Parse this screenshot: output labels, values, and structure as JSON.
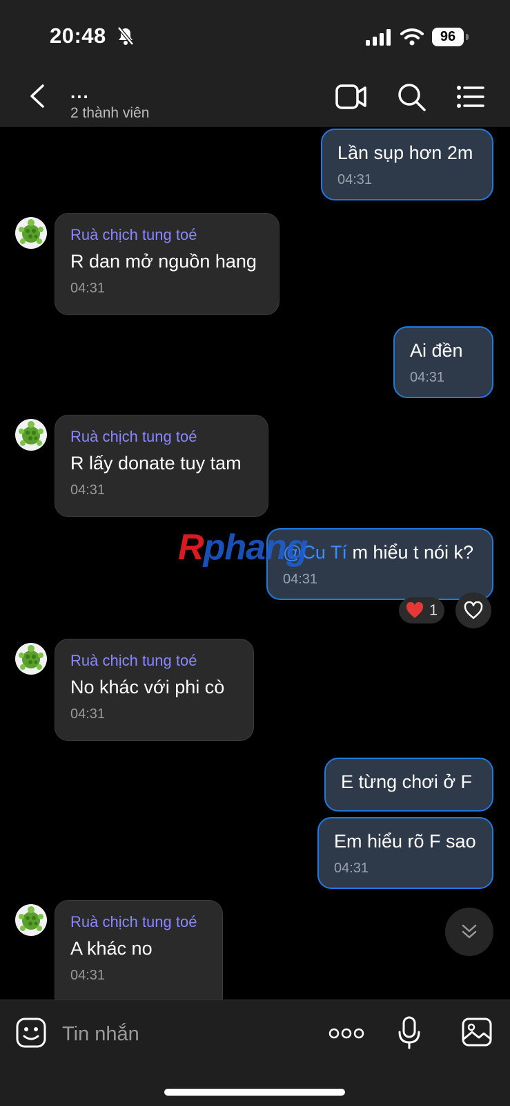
{
  "status_bar": {
    "time": "20:48",
    "battery": "96"
  },
  "header": {
    "title": "...",
    "subtitle": "2 thành viên"
  },
  "messages": [
    {
      "type": "out",
      "text": "Lần sụp hơn 2m",
      "time": "04:31"
    },
    {
      "type": "in",
      "sender": "Ruà chịch tung toé",
      "text": "R dan mở nguồn hang",
      "time": "04:31"
    },
    {
      "type": "out",
      "text": "Ai đền",
      "time": "04:31"
    },
    {
      "type": "in",
      "sender": "Ruà chịch tung toé",
      "text": "R lấy donate tuy tam",
      "time": "04:31"
    },
    {
      "type": "out",
      "mention": "@Cu Tí",
      "text": " m hiểu t nói k?",
      "time": "04:31",
      "reaction_count": "1"
    },
    {
      "type": "in",
      "sender": "Ruà chịch tung toé",
      "text": "No khác với phi cò",
      "time": "04:31"
    },
    {
      "type": "out",
      "text": "E từng chơi ở F"
    },
    {
      "type": "out",
      "text": "Em hiểu rõ F sao",
      "time": "04:31"
    },
    {
      "type": "in",
      "sender": "Ruà chịch tung toé",
      "text": "A khác no",
      "time": "04:31"
    }
  ],
  "watermark": {
    "r": "R",
    "rest": "phang"
  },
  "composer": {
    "placeholder": "Tin nhắn"
  },
  "colors": {
    "outgoing_bg": "#2e3a4a",
    "outgoing_border": "#1f7ae0",
    "incoming_bg": "#2a2a2a",
    "sender": "#8a86ff",
    "mention": "#3a8cff"
  }
}
